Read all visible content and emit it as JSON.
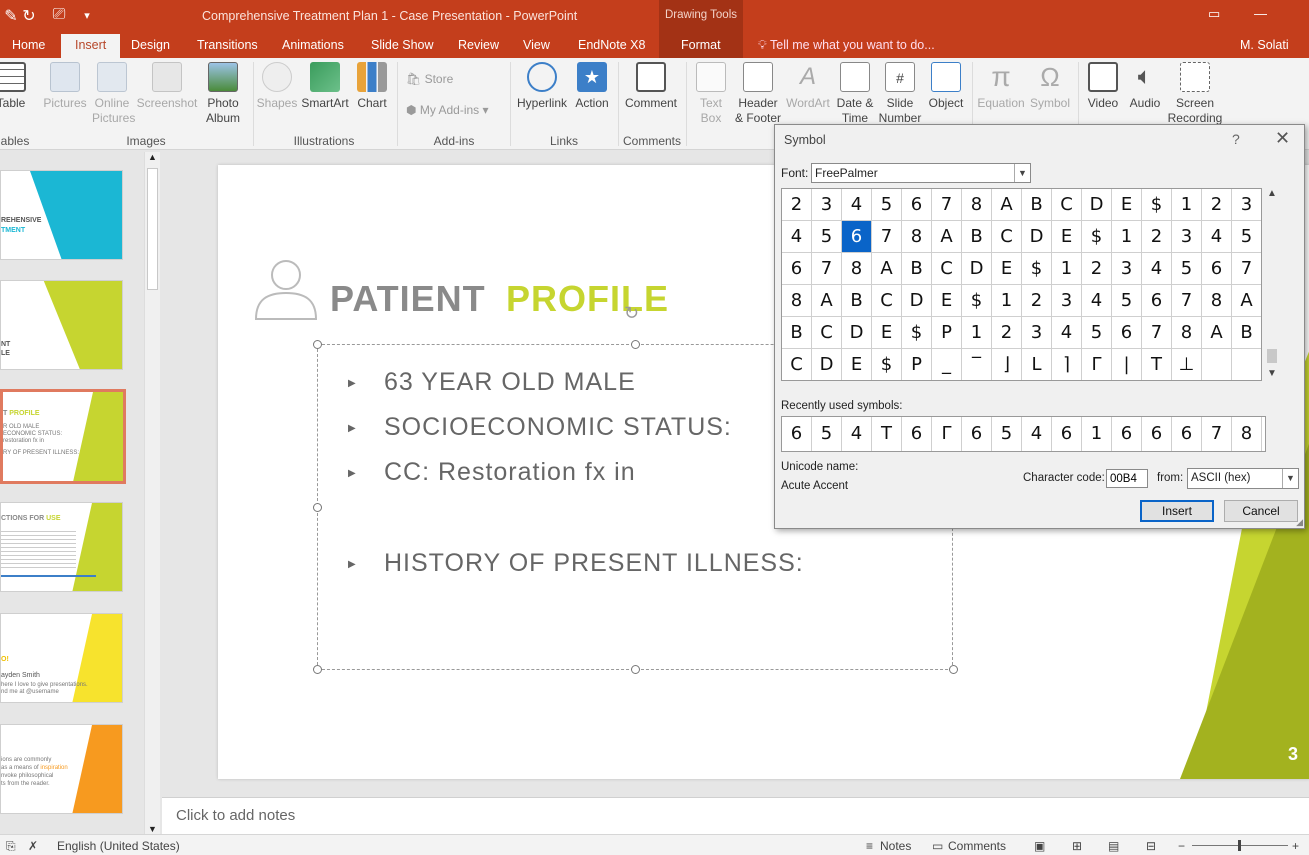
{
  "titlebar": {
    "title": "Comprehensive Treatment Plan 1 - Case Presentation - PowerPoint",
    "context_header": "Drawing Tools"
  },
  "tabs": {
    "home": "Home",
    "insert": "Insert",
    "design": "Design",
    "transitions": "Transitions",
    "animations": "Animations",
    "slide_show": "Slide Show",
    "review": "Review",
    "view": "View",
    "endnote": "EndNote X8",
    "format": "Format",
    "tell_me": "Tell me what you want to do...",
    "user": "M. Solati"
  },
  "ribbon": {
    "table": "Table",
    "pictures": "Pictures",
    "online_pictures_1": "Online",
    "online_pictures_2": "Pictures",
    "screenshot": "Screenshot",
    "photo_album_1": "Photo",
    "photo_album_2": "Album",
    "shapes": "Shapes",
    "smartart": "SmartArt",
    "chart": "Chart",
    "store": "Store",
    "my_addins": "My Add-ins",
    "hyperlink": "Hyperlink",
    "action": "Action",
    "comment": "Comment",
    "text_box_1": "Text",
    "text_box_2": "Box",
    "header_footer_1": "Header",
    "header_footer_2": "& Footer",
    "wordart": "WordArt",
    "date_time_1": "Date &",
    "date_time_2": "Time",
    "slide_number_1": "Slide",
    "slide_number_2": "Number",
    "object": "Object",
    "equation": "Equation",
    "symbol": "Symbol",
    "video": "Video",
    "audio": "Audio",
    "screen_recording_1": "Screen",
    "screen_recording_2": "Recording",
    "groups": {
      "tables": "ables",
      "images": "Images",
      "illustrations": "Illustrations",
      "addins": "Add-ins",
      "links": "Links",
      "comments": "Comments"
    }
  },
  "thumbnails": {
    "t1_a": "REHENSIVE",
    "t1_b": "TMENT",
    "t2_a": "NT",
    "t2_b": "LE",
    "t3_a": "T ",
    "t3_b": "PROFILE",
    "t3_l1": "R OLD MALE",
    "t3_l2": "ECONOMIC STATUS:",
    "t3_l3": "restoration fx in",
    "t3_l4": "RY OF PRESENT ILLNESS:",
    "t4_a": "CTIONS FOR ",
    "t4_b": "USE",
    "t5_a": "O!",
    "t5_b": "ayden Smith",
    "t5_l1": "here I love to give presentations.",
    "t5_l2": "nd me at @username",
    "t6_l1": "ions are commonly",
    "t6_l2": "as a means of ",
    "t6_l2b": "inspiration",
    "t6_l3": "nvoke philosophical",
    "t6_l4": "ts from the reader."
  },
  "slide": {
    "title_part1": "PATIENT ",
    "title_part2": "PROFILE",
    "bullet1": "63 YEAR OLD MALE",
    "bullet2": "SOCIOECONOMIC STATUS:",
    "bullet3": "CC: Restoration fx in",
    "bullet4": "HISTORY OF PRESENT ILLNESS:",
    "number": "3"
  },
  "notes": {
    "placeholder": "Click to add notes"
  },
  "status": {
    "language": "English (United States)",
    "notes": "Notes",
    "comments": "Comments"
  },
  "dialog": {
    "title": "Symbol",
    "help": "?",
    "font_label": "Font:",
    "font_value": "FreePalmer",
    "recent_label": "Recently used symbols:",
    "unicode_label": "Unicode name:",
    "unicode_value": "Acute Accent",
    "char_code_label": "Character code:",
    "char_code_value": "00B4",
    "from_label": "from:",
    "from_value": "ASCII (hex)",
    "insert": "Insert",
    "cancel": "Cancel",
    "grid": [
      [
        "2",
        "3",
        "4",
        "5",
        "6",
        "7",
        "8",
        "A",
        "B",
        "C",
        "D",
        "E",
        "$",
        "1",
        "2",
        "3"
      ],
      [
        "4",
        "5",
        "6",
        "7",
        "8",
        "A",
        "B",
        "C",
        "D",
        "E",
        "$",
        "1",
        "2",
        "3",
        "4",
        "5"
      ],
      [
        "6",
        "7",
        "8",
        "A",
        "B",
        "C",
        "D",
        "E",
        "$",
        "1",
        "2",
        "3",
        "4",
        "5",
        "6",
        "7"
      ],
      [
        "8",
        "A",
        "B",
        "C",
        "D",
        "E",
        "$",
        "1",
        "2",
        "3",
        "4",
        "5",
        "6",
        "7",
        "8",
        "A"
      ],
      [
        "B",
        "C",
        "D",
        "E",
        "$",
        "P",
        "1",
        "2",
        "3",
        "4",
        "5",
        "6",
        "7",
        "8",
        "A",
        "B"
      ],
      [
        "C",
        "D",
        "E",
        "$",
        "P",
        "_",
        "‾",
        "⌋",
        "L",
        "⌉",
        "Γ",
        "|",
        "T",
        "⊥",
        "",
        ""
      ]
    ],
    "recent": [
      "6",
      "5",
      "4",
      "T",
      "6",
      "Γ",
      "6",
      "5",
      "4",
      "6",
      "1",
      "6",
      "6",
      "6",
      "7",
      "8"
    ]
  }
}
